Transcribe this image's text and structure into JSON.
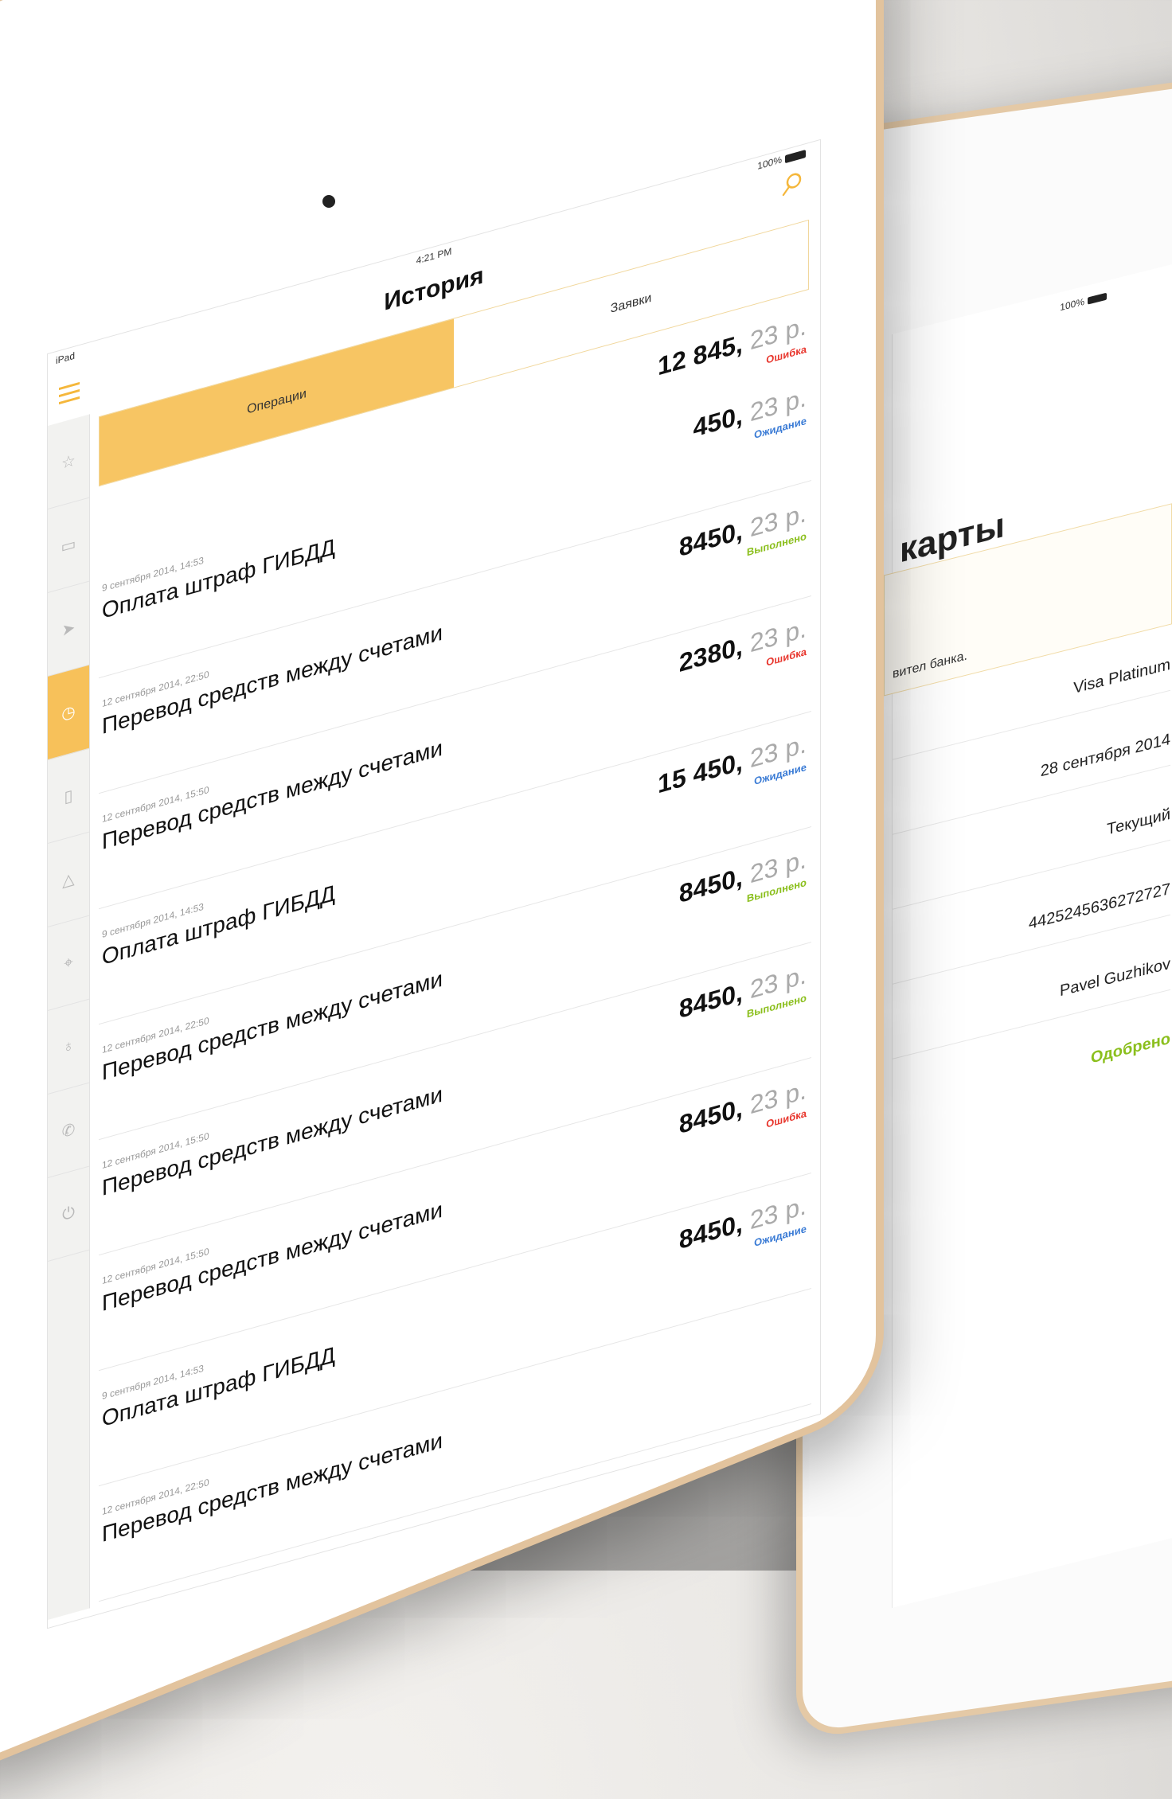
{
  "device_back": {
    "battery": "100%",
    "title": "карты",
    "notice": "вител банка.",
    "rows": [
      {
        "value": "Visa Platinum"
      },
      {
        "value": "28 сентября 2014"
      },
      {
        "value": "Текущий"
      },
      {
        "value": "4425245636272727"
      },
      {
        "value": "Pavel Guzhikov"
      },
      {
        "value": "Одобрено"
      }
    ]
  },
  "device_main": {
    "carrier": "iPad",
    "time": "4:21 PM",
    "battery": "100%",
    "page_title": "История",
    "tabs": [
      "Операции",
      "Заявки"
    ],
    "sidebar_icons": [
      "star-icon",
      "card-icon",
      "send-icon",
      "history-icon",
      "document-icon",
      "warning-icon",
      "map-icon",
      "bulb-icon",
      "phone-icon",
      "power-icon"
    ],
    "header_amount": {
      "whole": "12 845,",
      "kop": "23 р.",
      "status": "Ошибка"
    },
    "transactions": [
      {
        "date": "9 сентября 2014, 14:53",
        "title": "Оплата штраф ГИБДД",
        "amount_whole": "450,",
        "amount_kop": "23 р.",
        "status": "Ожидание"
      },
      {
        "date": "12 сентября 2014, 22:50",
        "title": "Перевод средств между счетами",
        "amount_whole": "8450,",
        "amount_kop": "23 р.",
        "status": "Выполнено"
      },
      {
        "date": "12 сентября 2014, 15:50",
        "title": "Перевод средств между счетами",
        "amount_whole": "2380,",
        "amount_kop": "23 р.",
        "status": "Ошибка"
      },
      {
        "date": "9 сентября 2014, 14:53",
        "title": "Оплата штраф ГИБДД",
        "amount_whole": "15 450,",
        "amount_kop": "23 р.",
        "status": "Ожидание"
      },
      {
        "date": "12 сентября 2014, 22:50",
        "title": "Перевод средств между счетами",
        "amount_whole": "8450,",
        "amount_kop": "23 р.",
        "status": "Выполнено"
      },
      {
        "date": "12 сентября 2014, 15:50",
        "title": "Перевод средств между счетами",
        "amount_whole": "8450,",
        "amount_kop": "23 р.",
        "status": "Выполнено"
      },
      {
        "date": "12 сентября 2014, 15:50",
        "title": "Перевод средств между счетами",
        "amount_whole": "8450,",
        "amount_kop": "23 р.",
        "status": "Ошибка"
      },
      {
        "date": "9 сентября 2014, 14:53",
        "title": "Оплата штраф ГИБДД",
        "amount_whole": "8450,",
        "amount_kop": "23 р.",
        "status": "Ожидание"
      },
      {
        "date": "12 сентября 2014, 22:50",
        "title": "Перевод средств между счетами",
        "amount_whole": "",
        "amount_kop": "",
        "status": ""
      }
    ]
  },
  "colors": {
    "accent": "#f7c15a",
    "error": "#e8372e",
    "waiting": "#3a7bd5",
    "done": "#8bbf1d"
  }
}
